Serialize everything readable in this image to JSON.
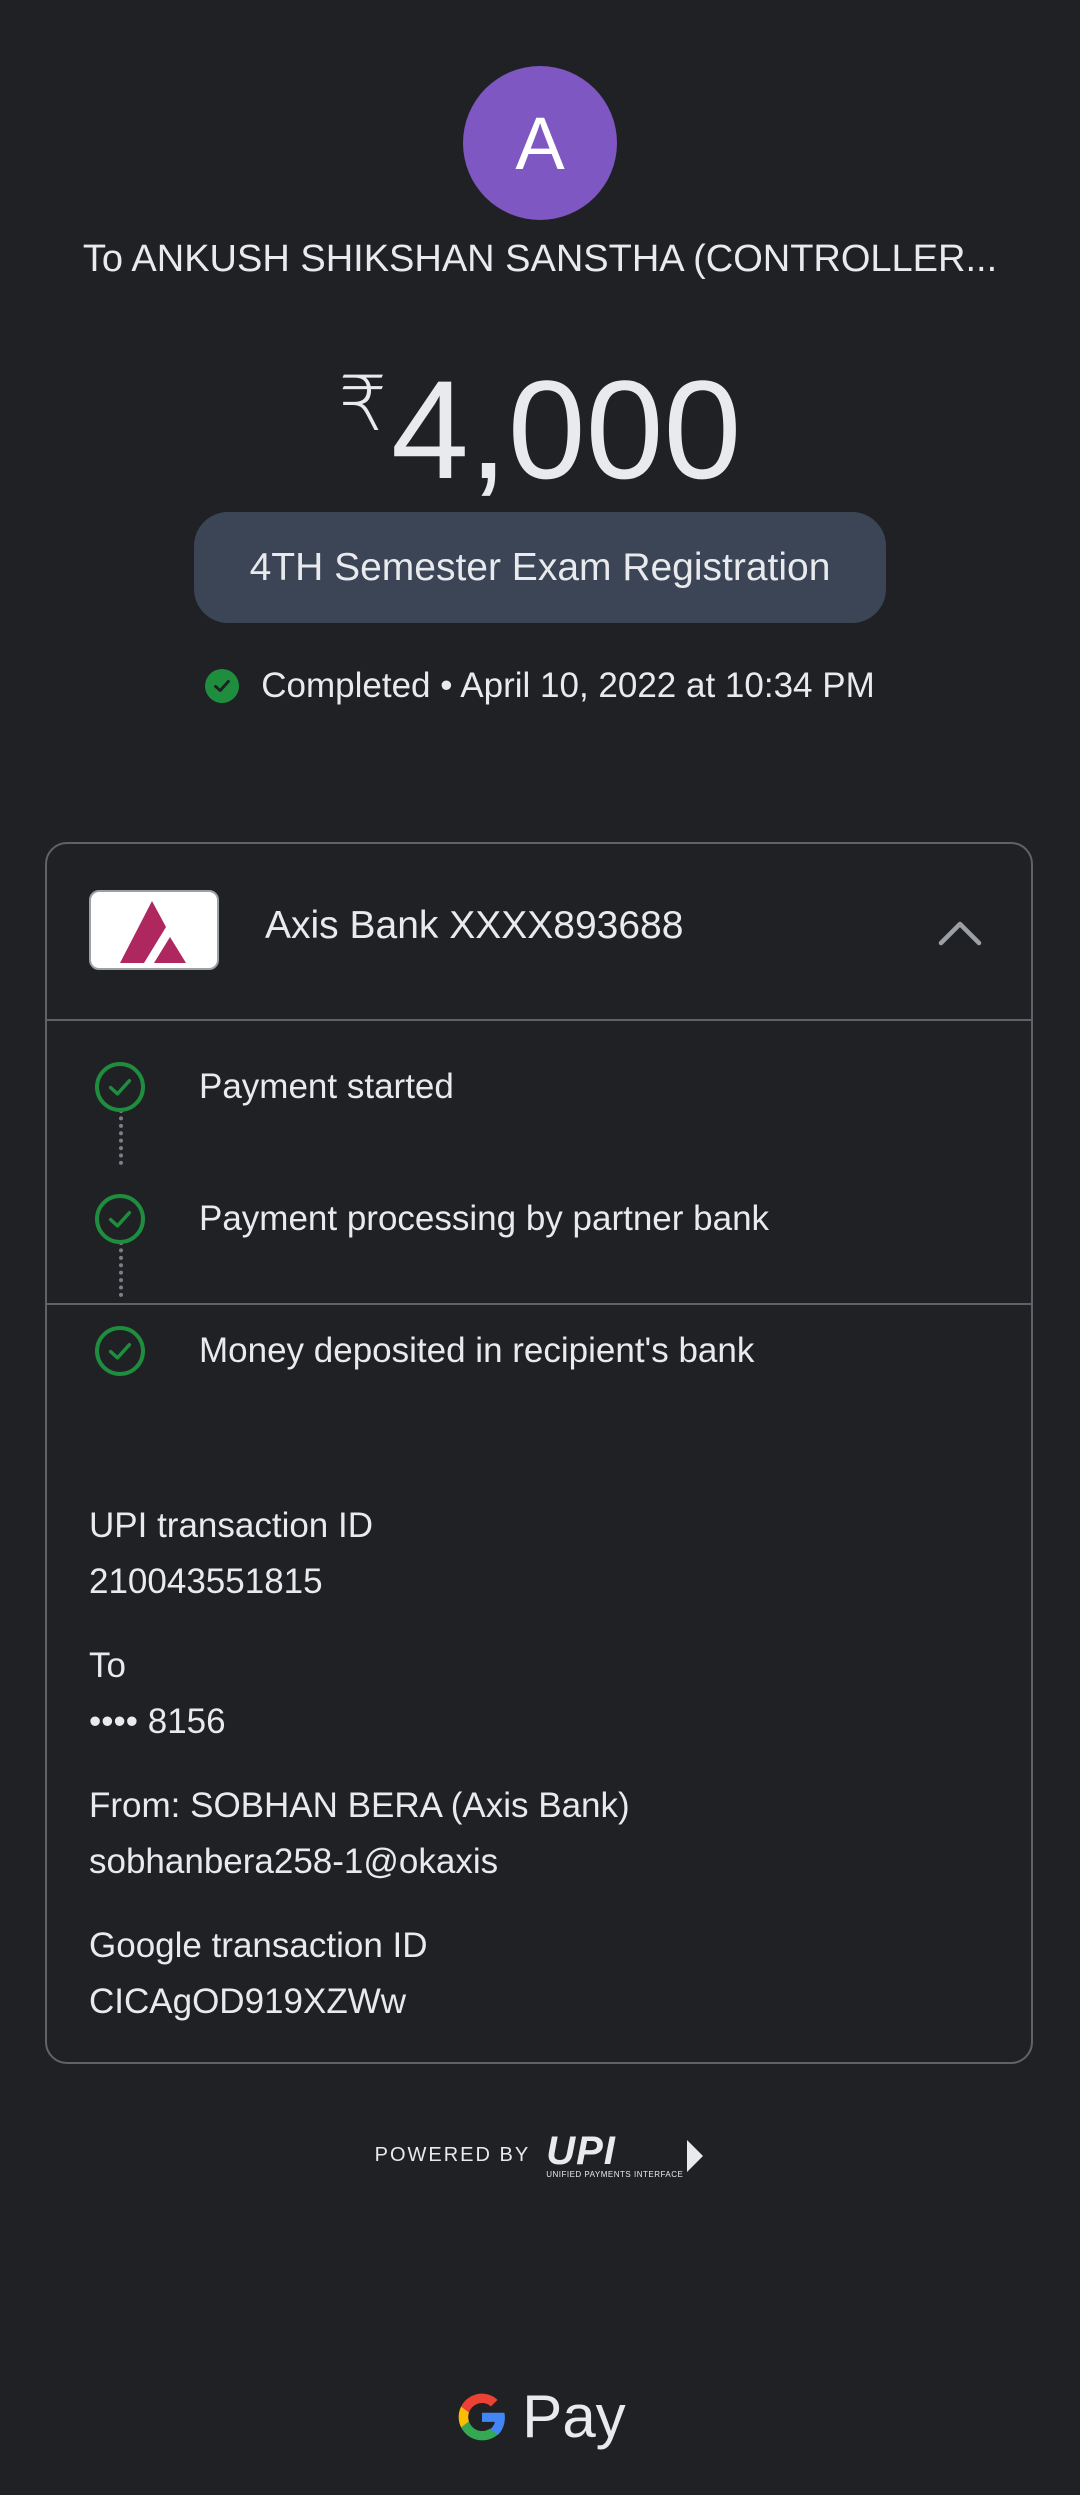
{
  "header": {
    "avatar_letter": "A",
    "recipient": "To ANKUSH SHIKSHAN SANSTHA (CONTROLLER...",
    "currency_symbol": "₹",
    "amount": "4,000",
    "note": "4TH Semester Exam Registration",
    "status": "Completed • April 10, 2022 at 10:34 PM"
  },
  "bank": {
    "name": "Axis Bank XXXX893688"
  },
  "steps": [
    {
      "label": "Payment started"
    },
    {
      "label": "Payment processing by partner bank"
    },
    {
      "label": "Money deposited in recipient's bank"
    }
  ],
  "details": {
    "upi_label": "UPI transaction ID",
    "upi_value": "210043551815",
    "to_label": "To",
    "to_value": "•••• 8156",
    "from_label": "From: SOBHAN BERA (Axis Bank)",
    "from_value": "sobhanbera258-1@okaxis",
    "google_label": "Google transaction ID",
    "google_value": "CICAgOD919XZWw"
  },
  "footer": {
    "powered_by": "POWERED BY",
    "upi_word": "UPI",
    "upi_sub": "UNIFIED PAYMENTS INTERFACE",
    "pay_word": "Pay"
  },
  "colors": {
    "background": "#202124",
    "avatar": "#7e57c2",
    "note_pill": "#3c4556",
    "success_green": "#1e8e3e",
    "divider": "#5f6368",
    "axis_maroon": "#ae275f"
  },
  "icons": [
    "check-circle-icon",
    "axis-bank-logo",
    "chevron-up-icon",
    "step-check-icon",
    "upi-logo",
    "google-g-logo"
  ]
}
